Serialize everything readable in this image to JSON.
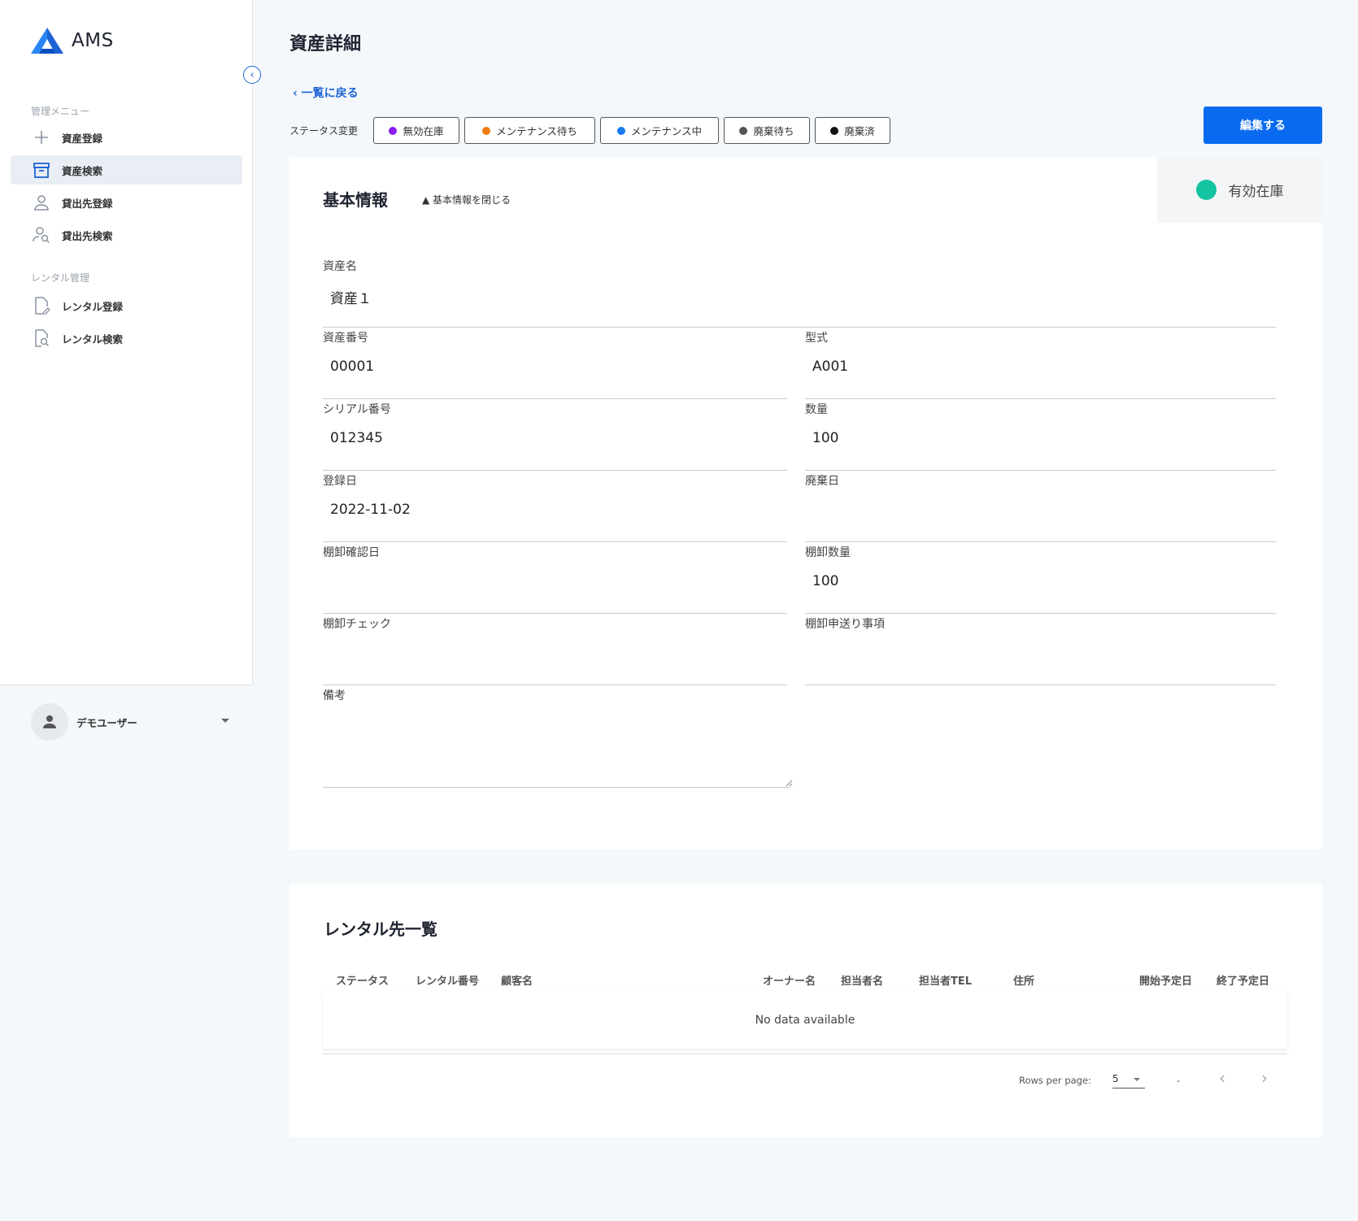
{
  "app": {
    "name": "AMS"
  },
  "sidebar": {
    "sections": [
      {
        "title": "管理メニュー"
      },
      {
        "title": "レンタル管理"
      }
    ],
    "items": [
      {
        "label": "資産登録",
        "icon": "plus-icon"
      },
      {
        "label": "資産検索",
        "icon": "archive-icon",
        "active": true
      },
      {
        "label": "貸出先登録",
        "icon": "person-icon"
      },
      {
        "label": "貸出先検索",
        "icon": "person-search-icon"
      },
      {
        "label": "レンタル登録",
        "icon": "document-edit-icon"
      },
      {
        "label": "レンタル検索",
        "icon": "document-search-icon"
      }
    ],
    "user": {
      "name": "デモユーザー"
    }
  },
  "header": {
    "title": "資産詳細",
    "back_label": "一覧に戻る",
    "status_change_label": "ステータス変更",
    "edit_label": "編集する"
  },
  "status_options": [
    {
      "label": "無効在庫",
      "color": "#8a1cf0"
    },
    {
      "label": "メンテナンス待ち",
      "color": "#f07c10"
    },
    {
      "label": "メンテナンス中",
      "color": "#1a7cf2"
    },
    {
      "label": "廃棄待ち",
      "color": "#555555"
    },
    {
      "label": "廃棄済",
      "color": "#111111"
    }
  ],
  "current_status": {
    "label": "有効在庫",
    "color": "#14c3a2"
  },
  "basic_info": {
    "title": "基本情報",
    "toggle_label": "▲ 基本情報を閉じる",
    "fields": {
      "asset_name": {
        "label": "資産名",
        "value": "資産１"
      },
      "asset_number": {
        "label": "資産番号",
        "value": "00001"
      },
      "model": {
        "label": "型式",
        "value": "A001"
      },
      "serial_number": {
        "label": "シリアル番号",
        "value": "012345"
      },
      "quantity": {
        "label": "数量",
        "value": "100"
      },
      "registered_date": {
        "label": "登録日",
        "value": "2022-11-02"
      },
      "disposal_date": {
        "label": "廃棄日",
        "value": ""
      },
      "inventory_check_date": {
        "label": "棚卸確認日",
        "value": ""
      },
      "inventory_quantity": {
        "label": "棚卸数量",
        "value": "100"
      },
      "inventory_check": {
        "label": "棚卸チェック",
        "value": ""
      },
      "inventory_notes": {
        "label": "棚卸申送り事項",
        "value": ""
      },
      "remarks": {
        "label": "備考",
        "value": ""
      }
    }
  },
  "rental_list": {
    "title": "レンタル先一覧",
    "columns": [
      "ステータス",
      "レンタル番号",
      "顧客名",
      "オーナー名",
      "担当者名",
      "担当者TEL",
      "住所",
      "開始予定日",
      "終了予定日"
    ],
    "empty_text": "No data available",
    "rows_per_page_label": "Rows per page:",
    "rows_per_page": "5",
    "range_text": "-"
  }
}
